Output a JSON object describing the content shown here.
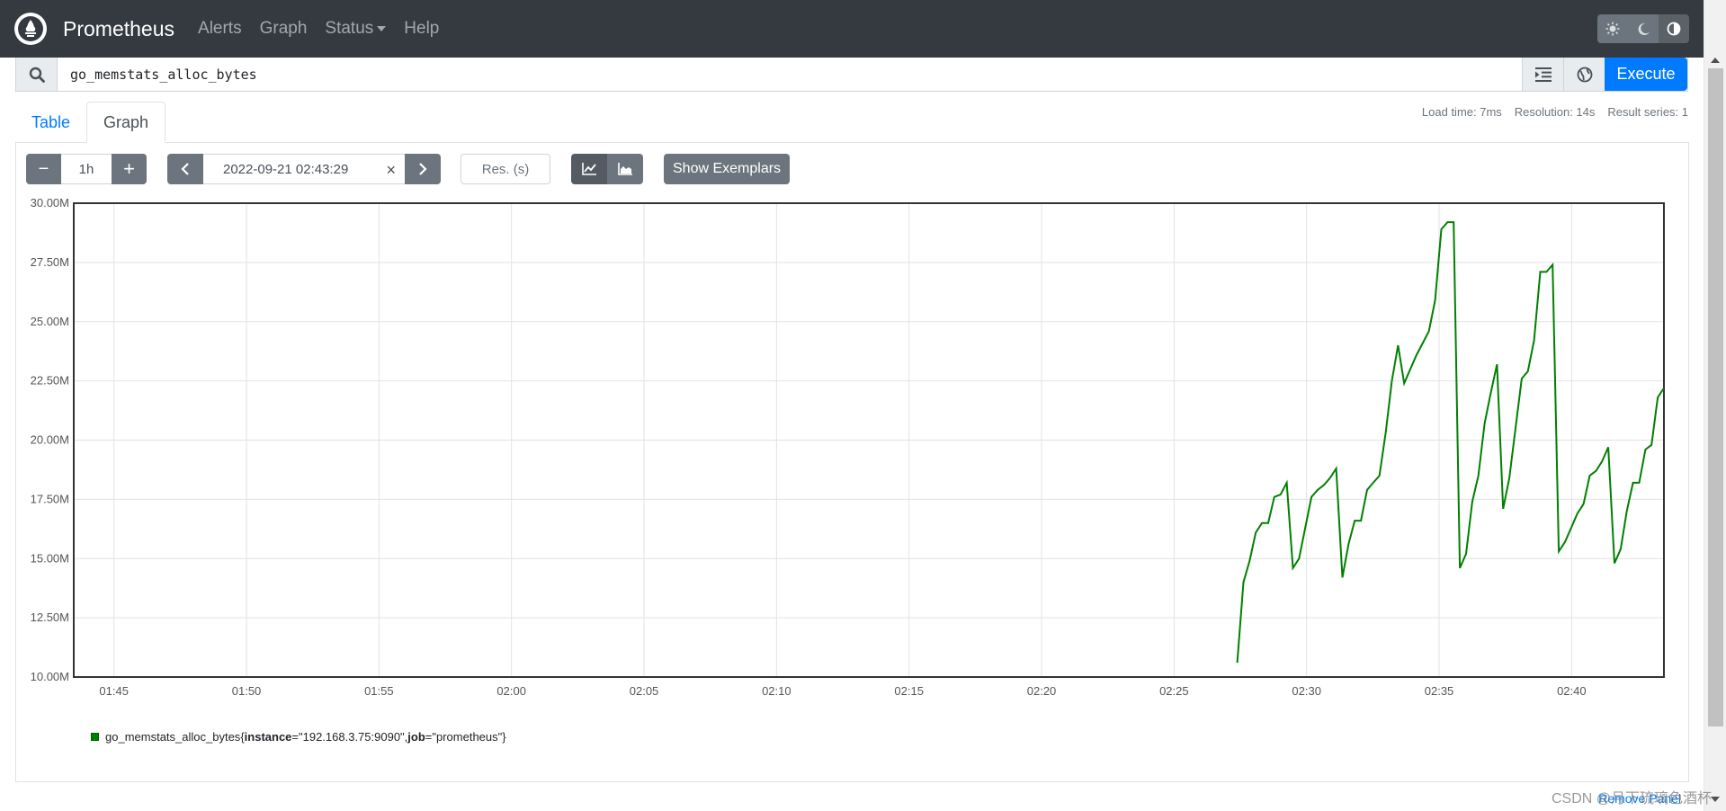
{
  "navbar": {
    "brand": "Prometheus",
    "links": [
      "Alerts",
      "Graph",
      "Status",
      "Help"
    ]
  },
  "query": {
    "expression": "go_memstats_alloc_bytes",
    "execute_label": "Execute"
  },
  "tabs": {
    "table": "Table",
    "graph": "Graph"
  },
  "stats": {
    "load_time": "Load time: 7ms",
    "resolution": "Resolution: 14s",
    "result_series": "Result series: 1"
  },
  "controls": {
    "minus": "−",
    "range": "1h",
    "plus": "+",
    "end_time": "2022-09-21 02:43:29",
    "clear": "×",
    "res_placeholder": "Res. (s)",
    "show_exemplars": "Show Exemplars"
  },
  "chart_data": {
    "type": "line",
    "ylim": [
      10000000,
      30000000
    ],
    "y_ticks": [
      "30.00M",
      "27.50M",
      "25.00M",
      "22.50M",
      "20.00M",
      "17.50M",
      "15.00M",
      "12.50M",
      "10.00M"
    ],
    "x_ticks": [
      "01:45",
      "01:50",
      "01:55",
      "02:00",
      "02:05",
      "02:10",
      "02:15",
      "02:20",
      "02:25",
      "02:30",
      "02:35",
      "02:40"
    ],
    "xlim": [
      "01:43:29",
      "02:43:29"
    ],
    "grid": true,
    "series": [
      {
        "name": "go_memstats_alloc_bytes{instance=\"192.168.3.75:9090\", job=\"prometheus\"}",
        "color": "#008000",
        "x": [
          "02:27:23",
          "02:27:37",
          "02:27:51",
          "02:28:05",
          "02:28:19",
          "02:28:33",
          "02:28:47",
          "02:29:01",
          "02:29:15",
          "02:29:29",
          "02:29:43",
          "02:29:57",
          "02:30:11",
          "02:30:25",
          "02:30:39",
          "02:30:53",
          "02:31:07",
          "02:31:21",
          "02:31:35",
          "02:31:49",
          "02:32:03",
          "02:32:17",
          "02:32:31",
          "02:32:45",
          "02:32:59",
          "02:33:13",
          "02:33:27",
          "02:33:41",
          "02:33:55",
          "02:34:09",
          "02:34:23",
          "02:34:37",
          "02:34:51",
          "02:35:05",
          "02:35:19",
          "02:35:33",
          "02:35:47",
          "02:36:01",
          "02:36:15",
          "02:36:29",
          "02:36:43",
          "02:36:57",
          "02:37:11",
          "02:37:25",
          "02:37:39",
          "02:37:53",
          "02:38:07",
          "02:38:21",
          "02:38:35",
          "02:38:49",
          "02:39:03",
          "02:39:17",
          "02:39:31",
          "02:39:45",
          "02:39:59",
          "02:40:13",
          "02:40:27",
          "02:40:41",
          "02:40:55",
          "02:41:09",
          "02:41:23",
          "02:41:37",
          "02:41:51",
          "02:42:05",
          "02:42:19",
          "02:42:33",
          "02:42:47",
          "02:43:01",
          "02:43:15",
          "02:43:29"
        ],
        "values": [
          10.6,
          14.0,
          14.9,
          16.1,
          16.5,
          16.5,
          17.6,
          17.7,
          18.2,
          14.6,
          15.0,
          16.3,
          17.6,
          17.9,
          18.1,
          18.4,
          18.8,
          14.2,
          15.6,
          16.6,
          16.6,
          17.9,
          18.2,
          18.5,
          20.3,
          22.5,
          24.0,
          22.4,
          23.0,
          23.6,
          24.1,
          24.6,
          25.9,
          28.9,
          29.2,
          29.2,
          14.6,
          15.2,
          17.4,
          18.5,
          20.7,
          22.0,
          23.2,
          17.1,
          18.4,
          20.5,
          22.6,
          22.9,
          24.2,
          27.1,
          27.1,
          27.4,
          15.3,
          15.7,
          16.3,
          16.9,
          17.3,
          18.5,
          18.7,
          19.1,
          19.7,
          14.8,
          15.4,
          17.0,
          18.2,
          18.2,
          19.6,
          19.8,
          21.8,
          22.2
        ]
      }
    ]
  },
  "legend": {
    "metric": "go_memstats_alloc_bytes",
    "open": "{",
    "label1_key": "instance",
    "label1_val": "=\"192.168.3.75:9090\", ",
    "label2_key": "job",
    "label2_val": "=\"prometheus\"",
    "close": "}"
  },
  "remove_panel": "Remove Panel",
  "watermark": "CSDN @月下琉璃色酒杯"
}
